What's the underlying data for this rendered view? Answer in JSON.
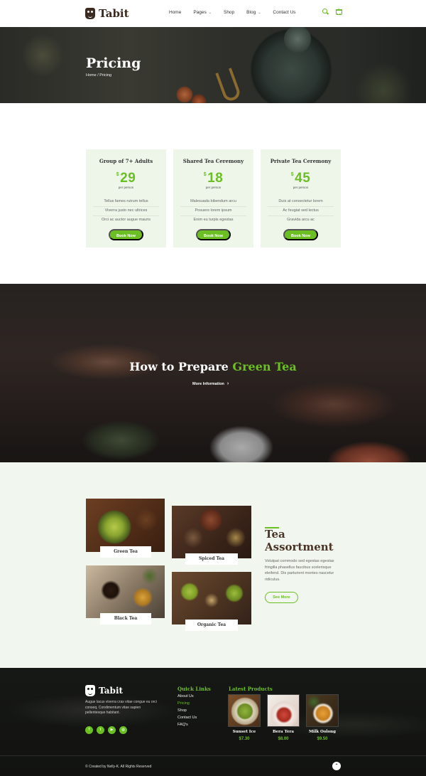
{
  "header": {
    "logo_text": "Tabit",
    "nav": [
      {
        "label": "Home",
        "has_dropdown": false
      },
      {
        "label": "Pages",
        "has_dropdown": true
      },
      {
        "label": "Shop",
        "has_dropdown": false
      },
      {
        "label": "Blog",
        "has_dropdown": true
      },
      {
        "label": "Contact Us",
        "has_dropdown": false
      }
    ],
    "cart_count": "0",
    "search_icon": "search-icon",
    "cart_icon": "cart-icon"
  },
  "hero": {
    "title": "Pricing",
    "breadcrumb": "Home / Pricing"
  },
  "pricing": [
    {
      "title": "Group of 7+ Adults",
      "currency": "$",
      "price": "29",
      "per": "per person",
      "features": [
        "Tellus fames rutrum tellus",
        "Viverra justo nec ultrices",
        "Orci ac auctor augue mauris"
      ],
      "button": "Book Now"
    },
    {
      "title": "Shared Tea Ceremony",
      "currency": "$",
      "price": "18",
      "per": "per person",
      "features": [
        "Malesuada bibendum arcu",
        "Posuere lorem ipsum",
        "Enim eu turpis egestas"
      ],
      "button": "Book Now"
    },
    {
      "title": "Private Tea Ceremony",
      "currency": "$",
      "price": "45",
      "per": "per person",
      "features": [
        "Duis at consectetur lorem",
        "Ac feugiat sed lectus",
        "Gravida arcu ac"
      ],
      "button": "Book Now"
    }
  ],
  "banner": {
    "title_part1": "How to Prepare ",
    "title_part2": "Green Tea",
    "link": "More Information"
  },
  "assortment": {
    "title_line1": "Tea",
    "title_line2": "Assortment",
    "text": "Volutpat commodo sed egestas egestas fringilla phasellus faucibus scelerisque eleifend. Dis parturient montes nascetur ridiculus.",
    "button": "See More",
    "tiles": [
      {
        "label": "Green Tea"
      },
      {
        "label": "Spiced Tea"
      },
      {
        "label": "Black Tea"
      },
      {
        "label": "Organic Tea"
      }
    ]
  },
  "footer": {
    "logo_text": "Tabit",
    "about": "Augue lacus viverra cras vitae congue eu orci conseq. Condimentum vitae sapien pellentesque habitant.",
    "socials": [
      "facebook-icon",
      "twitter-icon",
      "youtube-icon",
      "dribbble-icon"
    ],
    "quick_links_title": "Quick Links",
    "quick_links": [
      "About Us",
      "Pricing",
      "Shop",
      "Contact Us",
      "FAQ's"
    ],
    "latest_title": "Latest Products",
    "products": [
      {
        "name": "Sunset Ice",
        "price": "$7.30"
      },
      {
        "name": "Bera Tera",
        "price": "$8.00"
      },
      {
        "name": "Milk Oolong",
        "price": "$9.50"
      }
    ],
    "copyright": "© Created by Nelly-K. All Rights Reserved"
  },
  "colors": {
    "accent": "#6bbf23",
    "brand_dark": "#3a2a1f",
    "card_bg": "#eef6ea",
    "footer_bg": "#161815"
  }
}
